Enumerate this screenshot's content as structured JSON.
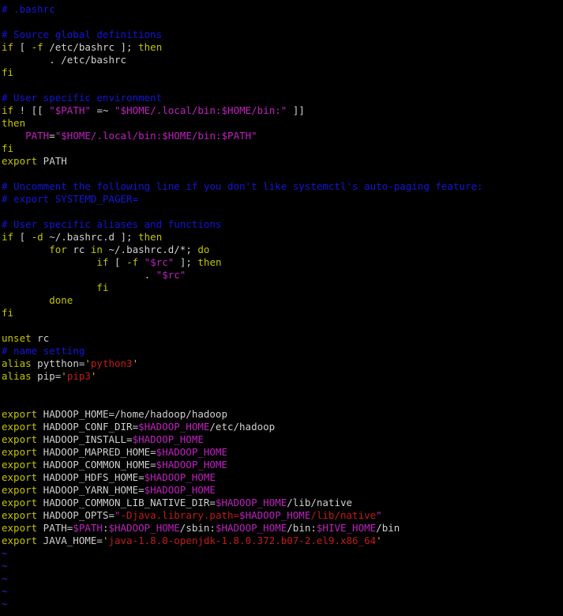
{
  "editor": {
    "lines": [
      [
        {
          "c": "c",
          "t": "# .bashrc"
        }
      ],
      [],
      [
        {
          "c": "c",
          "t": "# Source global definitions"
        }
      ],
      [
        {
          "c": "k",
          "t": "if"
        },
        {
          "c": "t",
          "t": " [ "
        },
        {
          "c": "k",
          "t": "-f"
        },
        {
          "c": "t",
          "t": " /etc/bashrc ]; "
        },
        {
          "c": "k",
          "t": "then"
        }
      ],
      [
        {
          "c": "t",
          "t": "        . /etc/bashrc"
        }
      ],
      [
        {
          "c": "k",
          "t": "fi"
        }
      ],
      [],
      [
        {
          "c": "c",
          "t": "# User specific environment"
        }
      ],
      [
        {
          "c": "k",
          "t": "if"
        },
        {
          "c": "t",
          "t": " ! [[ "
        },
        {
          "c": "p",
          "t": "\""
        },
        {
          "c": "v",
          "t": "$PATH"
        },
        {
          "c": "p",
          "t": "\""
        },
        {
          "c": "t",
          "t": " =~ "
        },
        {
          "c": "p",
          "t": "\""
        },
        {
          "c": "v",
          "t": "$HOME"
        },
        {
          "c": "p",
          "t": "/.local/bin:"
        },
        {
          "c": "v",
          "t": "$HOME"
        },
        {
          "c": "p",
          "t": "/bin:\""
        },
        {
          "c": "t",
          "t": " ]]"
        }
      ],
      [
        {
          "c": "k",
          "t": "then"
        }
      ],
      [
        {
          "c": "t",
          "t": "    "
        },
        {
          "c": "v",
          "t": "PATH"
        },
        {
          "c": "t",
          "t": "="
        },
        {
          "c": "p",
          "t": "\""
        },
        {
          "c": "v",
          "t": "$HOME"
        },
        {
          "c": "p",
          "t": "/.local/bin:"
        },
        {
          "c": "v",
          "t": "$HOME"
        },
        {
          "c": "p",
          "t": "/bin:"
        },
        {
          "c": "v",
          "t": "$PATH"
        },
        {
          "c": "p",
          "t": "\""
        }
      ],
      [
        {
          "c": "k",
          "t": "fi"
        }
      ],
      [
        {
          "c": "k",
          "t": "export"
        },
        {
          "c": "t",
          "t": " PATH"
        }
      ],
      [],
      [
        {
          "c": "c",
          "t": "# Uncomment the following line if you don't like systemctl's auto-paging feature:"
        }
      ],
      [
        {
          "c": "c",
          "t": "# export SYSTEMD_PAGER="
        }
      ],
      [],
      [
        {
          "c": "c",
          "t": "# User specific aliases and functions"
        }
      ],
      [
        {
          "c": "k",
          "t": "if"
        },
        {
          "c": "t",
          "t": " [ "
        },
        {
          "c": "k",
          "t": "-d"
        },
        {
          "c": "t",
          "t": " ~/.bashrc.d ]; "
        },
        {
          "c": "k",
          "t": "then"
        }
      ],
      [
        {
          "c": "t",
          "t": "        "
        },
        {
          "c": "k",
          "t": "for"
        },
        {
          "c": "t",
          "t": " rc "
        },
        {
          "c": "k",
          "t": "in"
        },
        {
          "c": "t",
          "t": " ~/.bashrc.d/*; "
        },
        {
          "c": "k",
          "t": "do"
        }
      ],
      [
        {
          "c": "t",
          "t": "                "
        },
        {
          "c": "k",
          "t": "if"
        },
        {
          "c": "t",
          "t": " [ "
        },
        {
          "c": "k",
          "t": "-f"
        },
        {
          "c": "t",
          "t": " "
        },
        {
          "c": "p",
          "t": "\""
        },
        {
          "c": "v",
          "t": "$rc"
        },
        {
          "c": "p",
          "t": "\""
        },
        {
          "c": "t",
          "t": " ]; "
        },
        {
          "c": "k",
          "t": "then"
        }
      ],
      [
        {
          "c": "t",
          "t": "                        . "
        },
        {
          "c": "p",
          "t": "\""
        },
        {
          "c": "v",
          "t": "$rc"
        },
        {
          "c": "p",
          "t": "\""
        }
      ],
      [
        {
          "c": "t",
          "t": "                "
        },
        {
          "c": "k",
          "t": "fi"
        }
      ],
      [
        {
          "c": "t",
          "t": "        "
        },
        {
          "c": "k",
          "t": "done"
        }
      ],
      [
        {
          "c": "k",
          "t": "fi"
        }
      ],
      [],
      [
        {
          "c": "k",
          "t": "unset"
        },
        {
          "c": "t",
          "t": " rc"
        }
      ],
      [
        {
          "c": "c",
          "t": "# name setting"
        }
      ],
      [
        {
          "c": "k",
          "t": "alias"
        },
        {
          "c": "t",
          "t": " pytthon="
        },
        {
          "c": "k",
          "t": "'"
        },
        {
          "c": "s",
          "t": "python3"
        },
        {
          "c": "k",
          "t": "'"
        }
      ],
      [
        {
          "c": "k",
          "t": "alias"
        },
        {
          "c": "t",
          "t": " pip="
        },
        {
          "c": "k",
          "t": "'"
        },
        {
          "c": "s",
          "t": "pip3"
        },
        {
          "c": "k",
          "t": "'"
        }
      ],
      [],
      [],
      [
        {
          "c": "k",
          "t": "export"
        },
        {
          "c": "t",
          "t": " HADOOP_HOME=/home/hadoop/hadoop"
        }
      ],
      [
        {
          "c": "k",
          "t": "export"
        },
        {
          "c": "t",
          "t": " HADOOP_CONF_DIR="
        },
        {
          "c": "v",
          "t": "$HADOOP_HOME"
        },
        {
          "c": "t",
          "t": "/etc/hadoop"
        }
      ],
      [
        {
          "c": "k",
          "t": "export"
        },
        {
          "c": "t",
          "t": " HADOOP_INSTALL="
        },
        {
          "c": "v",
          "t": "$HADOOP_HOME"
        }
      ],
      [
        {
          "c": "k",
          "t": "export"
        },
        {
          "c": "t",
          "t": " HADOOP_MAPRED_HOME="
        },
        {
          "c": "v",
          "t": "$HADOOP_HOME"
        }
      ],
      [
        {
          "c": "k",
          "t": "export"
        },
        {
          "c": "t",
          "t": " HADOOP_COMMON_HOME="
        },
        {
          "c": "v",
          "t": "$HADOOP_HOME"
        }
      ],
      [
        {
          "c": "k",
          "t": "export"
        },
        {
          "c": "t",
          "t": " HADOOP_HDFS_HOME="
        },
        {
          "c": "v",
          "t": "$HADOOP_HOME"
        }
      ],
      [
        {
          "c": "k",
          "t": "export"
        },
        {
          "c": "t",
          "t": " HADOOP_YARN_HOME="
        },
        {
          "c": "v",
          "t": "$HADOOP_HOME"
        }
      ],
      [
        {
          "c": "k",
          "t": "export"
        },
        {
          "c": "t",
          "t": " HADOOP_COMMON_LIB_NATIVE_DIR="
        },
        {
          "c": "v",
          "t": "$HADOOP_HOME"
        },
        {
          "c": "t",
          "t": "/lib/native"
        }
      ],
      [
        {
          "c": "k",
          "t": "export"
        },
        {
          "c": "t",
          "t": " HADOOP_OPTS="
        },
        {
          "c": "p",
          "t": "\""
        },
        {
          "c": "s",
          "t": "-Djava.library.path="
        },
        {
          "c": "v",
          "t": "$HADOOP_HOME"
        },
        {
          "c": "s",
          "t": "/lib/native"
        },
        {
          "c": "p",
          "t": "\""
        }
      ],
      [
        {
          "c": "k",
          "t": "export"
        },
        {
          "c": "t",
          "t": " PATH="
        },
        {
          "c": "v",
          "t": "$PATH"
        },
        {
          "c": "t",
          "t": ":"
        },
        {
          "c": "v",
          "t": "$HADOOP_HOME"
        },
        {
          "c": "t",
          "t": "/sbin:"
        },
        {
          "c": "v",
          "t": "$HADOOP_HOME"
        },
        {
          "c": "t",
          "t": "/bin:"
        },
        {
          "c": "v",
          "t": "$HIVE_HOME"
        },
        {
          "c": "t",
          "t": "/bin"
        }
      ],
      [
        {
          "c": "k",
          "t": "export"
        },
        {
          "c": "t",
          "t": " JAVA_HOME="
        },
        {
          "c": "k",
          "t": "'"
        },
        {
          "c": "s",
          "t": "java-1.8.0-openjdk-1.8.0.372.b07-2.el9.x86_64"
        },
        {
          "c": "k",
          "t": "'"
        }
      ],
      [
        {
          "c": "tilde",
          "t": "~"
        }
      ],
      [
        {
          "c": "tilde",
          "t": "~"
        }
      ],
      [
        {
          "c": "tilde",
          "t": "~"
        }
      ],
      [
        {
          "c": "tilde",
          "t": "~"
        }
      ],
      [
        {
          "c": "tilde",
          "t": "~"
        }
      ]
    ]
  },
  "colors": {
    "background": "#000000",
    "comment": "#1515d8",
    "keyword": "#c4c400",
    "text": "#cfcfcf",
    "variable": "#c020c0",
    "string": "#c21b1b",
    "tilde": "#2a2acc"
  }
}
